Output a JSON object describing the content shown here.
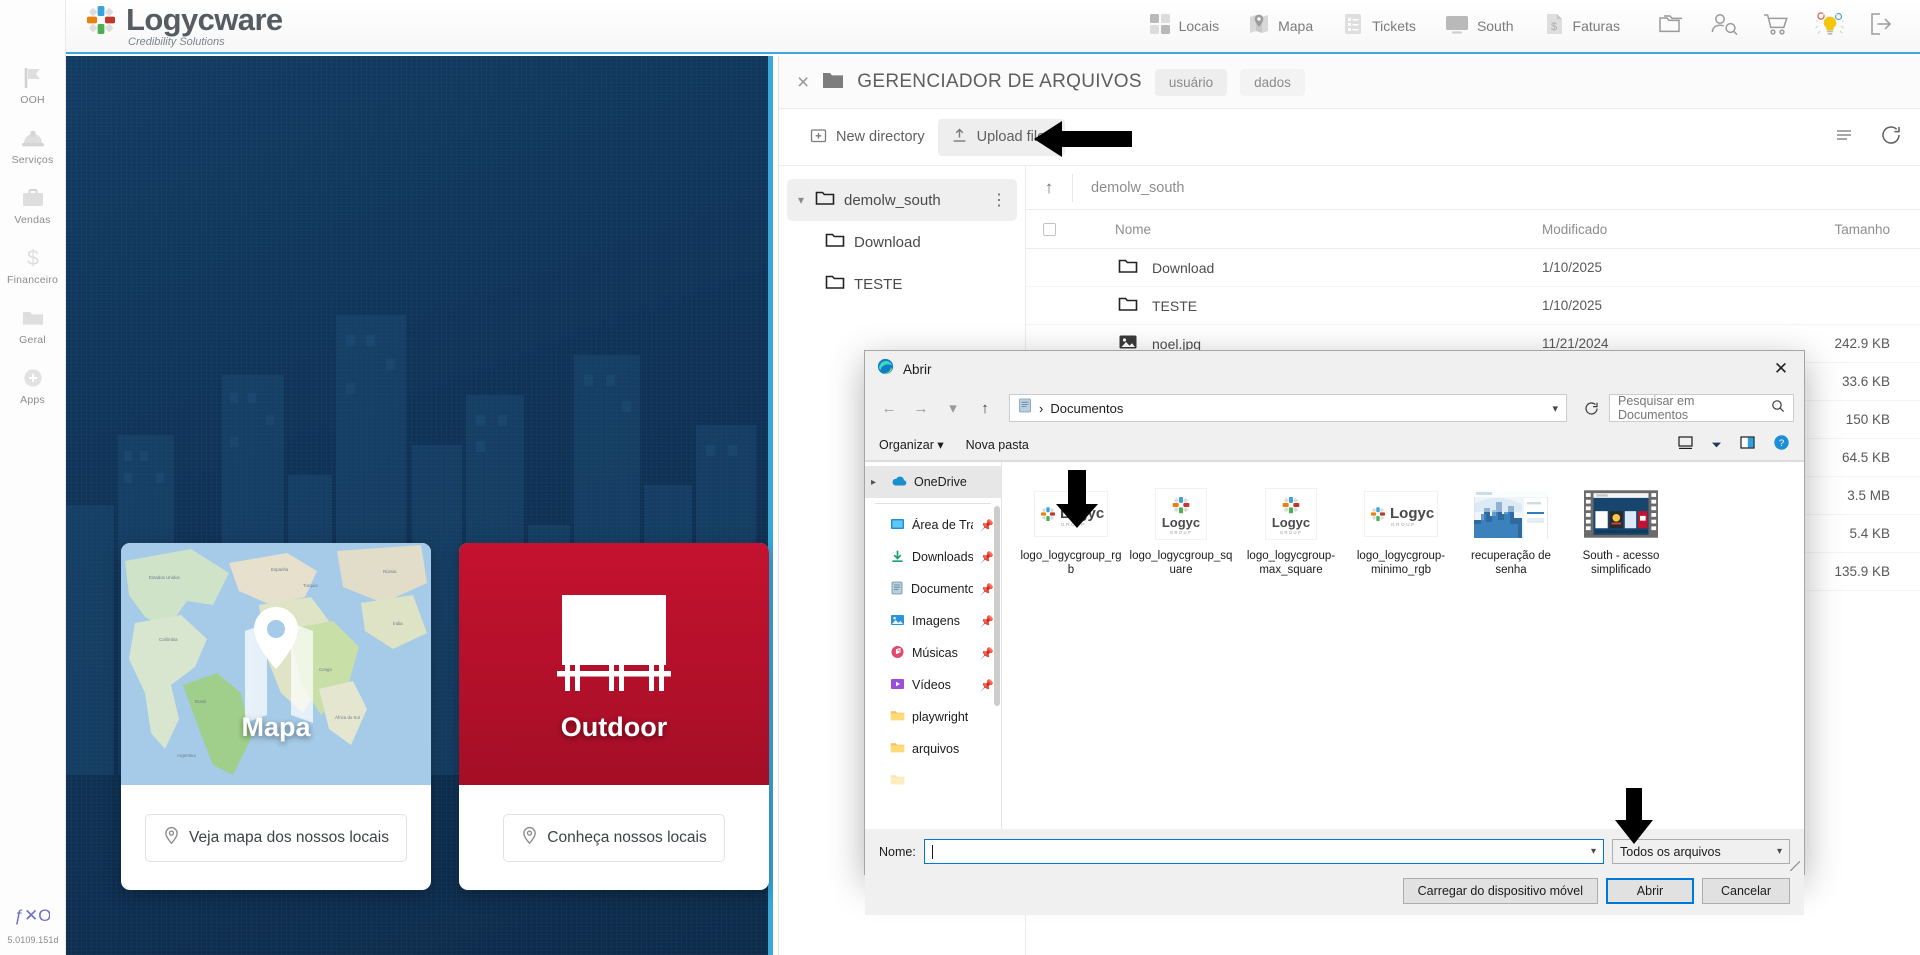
{
  "brand": {
    "name": "Logycware",
    "tagline": "Credibility Solutions"
  },
  "sidebar": {
    "items": [
      {
        "label": "OOH",
        "icon": "flag-icon"
      },
      {
        "label": "Serviços",
        "icon": "hardhat-icon"
      },
      {
        "label": "Vendas",
        "icon": "briefcase-icon"
      },
      {
        "label": "Financeiro",
        "icon": "dollar-icon"
      },
      {
        "label": "Geral",
        "icon": "folder-icon"
      },
      {
        "label": "Apps",
        "icon": "apps-plus-icon"
      }
    ],
    "footer": {
      "version": "5.0109.151d",
      "logo": "fxo-logo-icon"
    }
  },
  "topnav": {
    "items": [
      {
        "label": "Locais",
        "icon": "grid-squares-icon"
      },
      {
        "label": "Mapa",
        "icon": "map-pin-icon"
      },
      {
        "label": "Tickets",
        "icon": "checklist-icon"
      },
      {
        "label": "South",
        "icon": "monitor-icon"
      },
      {
        "label": "Faturas",
        "icon": "invoice-dollar-icon"
      }
    ],
    "icons": [
      {
        "name": "folders-icon"
      },
      {
        "name": "user-search-icon"
      },
      {
        "name": "shopping-cart-icon"
      },
      {
        "name": "lightbulb-ideas-icon"
      },
      {
        "name": "logout-icon"
      }
    ]
  },
  "page": {
    "cards": [
      {
        "title": "Mapa",
        "cta": "Veja mapa dos nossos locais",
        "cta_icon": "map-pin-outline-icon",
        "kind": "map"
      },
      {
        "title": "Outdoor",
        "cta": "Conheça nossos locais",
        "cta_icon": "map-pin-outline-icon",
        "kind": "billboard",
        "color": "#c41230"
      }
    ]
  },
  "filemanager": {
    "title": "GERENCIADOR DE ARQUIVOS",
    "close_label": "×",
    "tabs": [
      {
        "label": "usuário",
        "active": true
      },
      {
        "label": "dados",
        "active": false
      }
    ],
    "toolbar": {
      "new_directory": "New directory",
      "upload_files": "Upload files",
      "list_icon": "list-view-icon",
      "refresh_icon": "refresh-icon"
    },
    "tree": [
      {
        "label": "demolw_south",
        "level": 0,
        "selected": true,
        "expanded": true
      },
      {
        "label": "Download",
        "level": 1,
        "selected": false
      },
      {
        "label": "TESTE",
        "level": 1,
        "selected": false
      }
    ],
    "breadcrumb": "demolw_south",
    "columns": {
      "name": "Nome",
      "modified": "Modificado",
      "size": "Tamanho"
    },
    "rows": [
      {
        "name": "Download",
        "type": "folder",
        "modified": "1/10/2025",
        "size": ""
      },
      {
        "name": "TESTE",
        "type": "folder",
        "modified": "1/10/2025",
        "size": ""
      },
      {
        "name": "noel.jpg",
        "type": "image",
        "modified": "11/21/2024",
        "size": "242.9 KB"
      },
      {
        "name": "",
        "type": "file",
        "modified": "",
        "size": "33.6 KB"
      },
      {
        "name": "",
        "type": "file",
        "modified": "",
        "size": "150 KB"
      },
      {
        "name": "",
        "type": "file",
        "modified": "",
        "size": "64.5 KB"
      },
      {
        "name": "",
        "type": "file",
        "modified": "",
        "size": "3.5 MB"
      },
      {
        "name": "",
        "type": "file",
        "modified": "",
        "size": "5.4 KB"
      },
      {
        "name": "",
        "type": "file",
        "modified": "",
        "size": "135.9 KB"
      }
    ]
  },
  "dialog": {
    "title": "Abrir",
    "title_icon": "edge-browser-icon",
    "close": "✕",
    "address": {
      "crumb": "Documentos",
      "icon": "documents-icon",
      "separator": "›"
    },
    "search": {
      "placeholder": "Pesquisar em Documentos",
      "icon": "search-icon"
    },
    "commands": {
      "organize": "Organizar",
      "new_folder": "Nova pasta"
    },
    "view_icons": [
      {
        "name": "view-layout-icon"
      },
      {
        "name": "chevron-down-icon"
      },
      {
        "name": "preview-pane-icon"
      },
      {
        "name": "help-icon"
      }
    ],
    "sidebar": [
      {
        "label": "OneDrive",
        "icon": "onedrive-cloud-icon",
        "chevron": "›",
        "selected": true,
        "pinned": false
      },
      {
        "label": "Área de Traba",
        "icon": "desktop-icon",
        "pinned": true
      },
      {
        "label": "Downloads",
        "icon": "download-arrow-icon",
        "pinned": true
      },
      {
        "label": "Documentos",
        "icon": "documents-icon",
        "pinned": true
      },
      {
        "label": "Imagens",
        "icon": "pictures-icon",
        "pinned": true
      },
      {
        "label": "Músicas",
        "icon": "music-icon",
        "pinned": true
      },
      {
        "label": "Vídeos",
        "icon": "videos-icon",
        "pinned": true
      },
      {
        "label": "playwright",
        "icon": "folder-yellow-icon",
        "pinned": false
      },
      {
        "label": "arquivos",
        "icon": "folder-yellow-icon",
        "pinned": false
      }
    ],
    "files": [
      {
        "label": "logo_logycgroup_rgb",
        "thumb": "logyc-wide-logo"
      },
      {
        "label": "logo_logycgroup_square",
        "thumb": "logyc-square-logo"
      },
      {
        "label": "logo_logycgroup-max_square",
        "thumb": "logyc-square-logo"
      },
      {
        "label": "logo_logycgroup-minimo_rgb",
        "thumb": "logyc-wide-logo"
      },
      {
        "label": "recuperação de senha",
        "thumb": "screenshot-city"
      },
      {
        "label": "South - acesso simplificado",
        "thumb": "video-filmstrip"
      }
    ],
    "footer": {
      "name_label": "Nome:",
      "name_value": "",
      "filetype": "Todos os arquivos",
      "mobile_button": "Carregar do dispositivo móvel",
      "open_button": "Abrir",
      "cancel_button": "Cancelar"
    }
  },
  "annotations": {
    "arrows": [
      {
        "name": "arrow-upload-files",
        "direction": "left"
      },
      {
        "name": "arrow-first-file",
        "direction": "down"
      },
      {
        "name": "arrow-open-button",
        "direction": "down"
      }
    ]
  }
}
